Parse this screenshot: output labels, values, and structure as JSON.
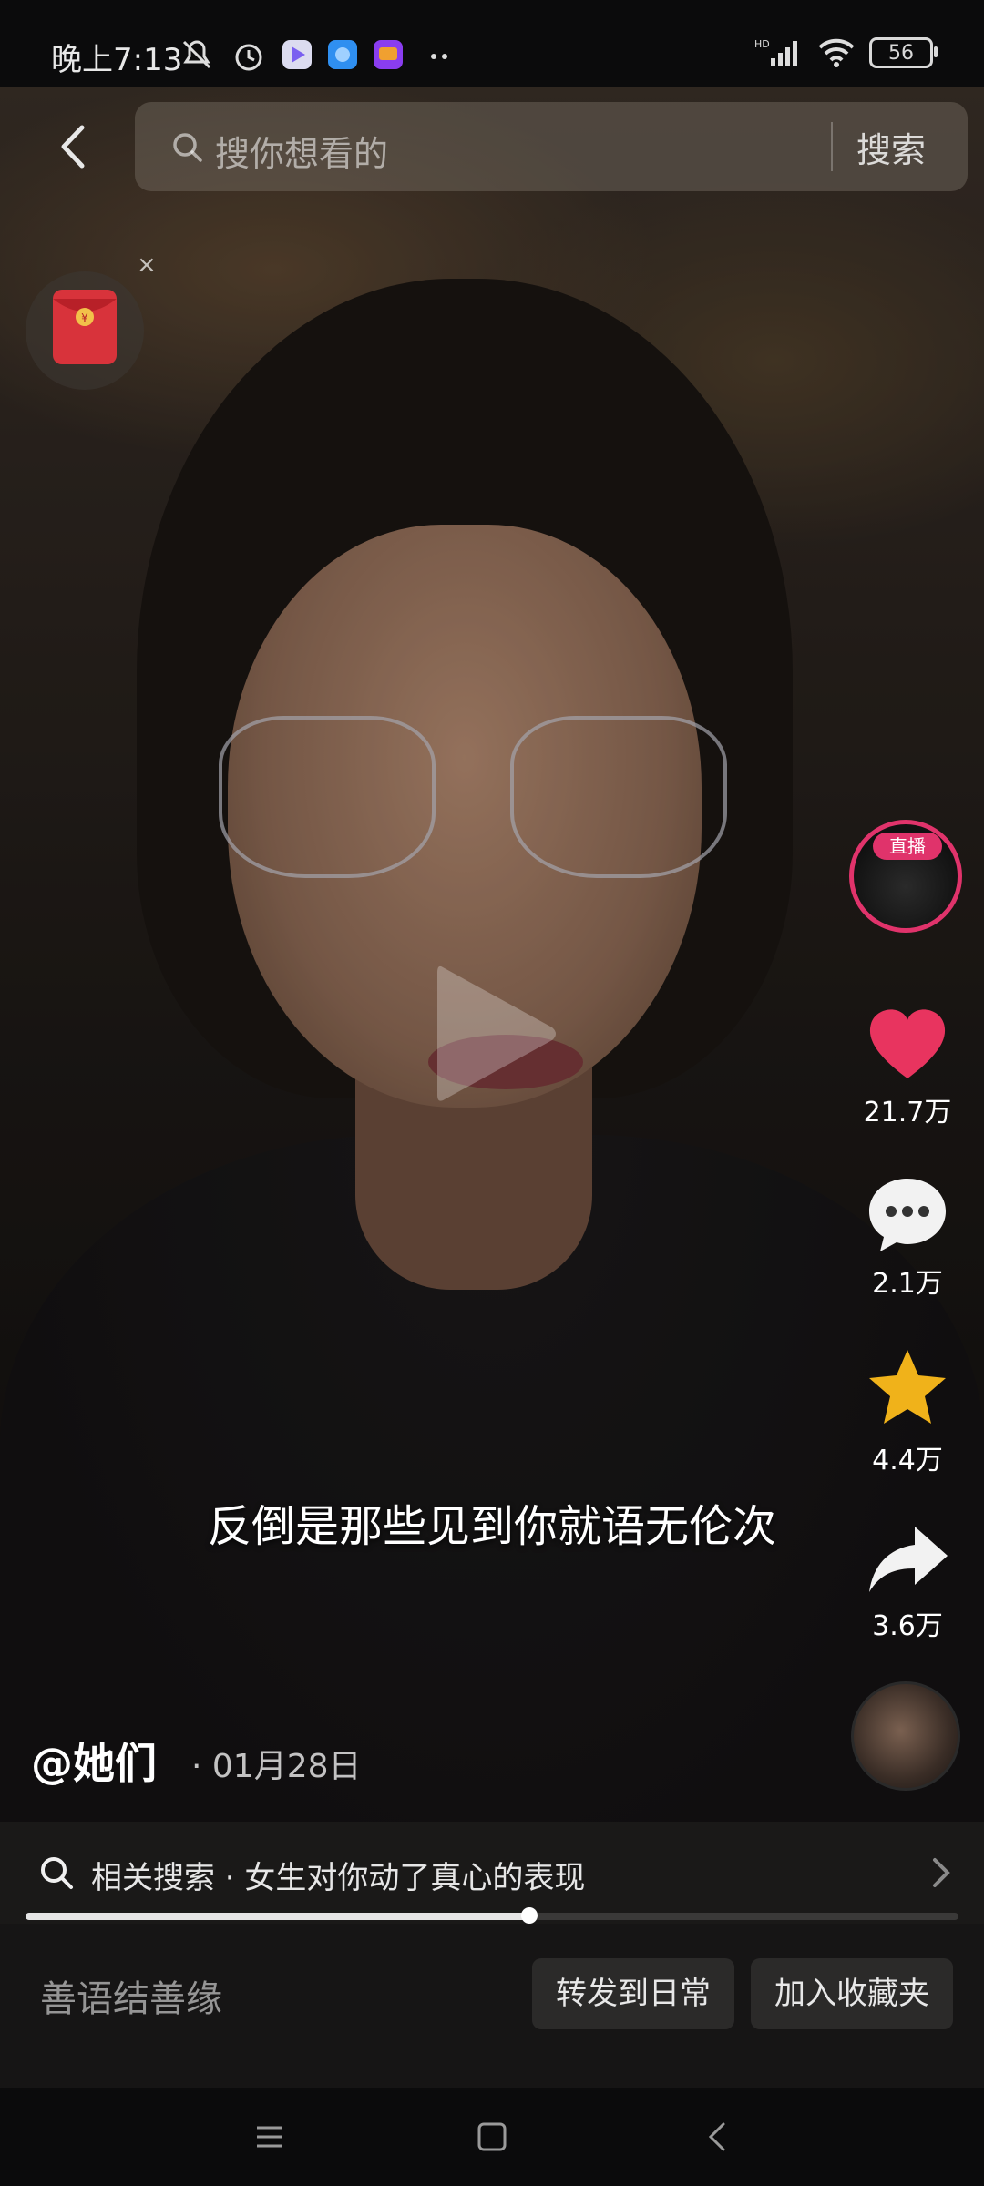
{
  "status_bar": {
    "time": "晚上7:13",
    "battery": "56"
  },
  "search": {
    "placeholder": "搜你想看的",
    "button_label": "搜索"
  },
  "video": {
    "subtitle": "反倒是那些见到你就语无伦次",
    "progress": 0.54
  },
  "live": {
    "badge": "直播"
  },
  "actions": {
    "likes": "21.7万",
    "comments": "2.1万",
    "favorites": "4.4万",
    "shares": "3.6万"
  },
  "author": {
    "handle": "@她们",
    "date": "· 01月28日"
  },
  "related_search": {
    "text": "相关搜索 · 女生对你动了真心的表现"
  },
  "bottom": {
    "comment_placeholder": "善语结善缘",
    "forward_label": "转发到日常",
    "favorite_label": "加入收藏夹"
  },
  "colors": {
    "like": "#e8345f",
    "favorite": "#f0b21a",
    "live_ring": "#e0336b",
    "redpacket": "#d8333b"
  },
  "icons": [
    "back-icon",
    "search-icon",
    "red-packet-icon",
    "play-icon",
    "heart-icon",
    "comment-icon",
    "star-icon",
    "share-icon",
    "chevron-right-icon",
    "menu-icon",
    "home-icon",
    "back-nav-icon"
  ]
}
